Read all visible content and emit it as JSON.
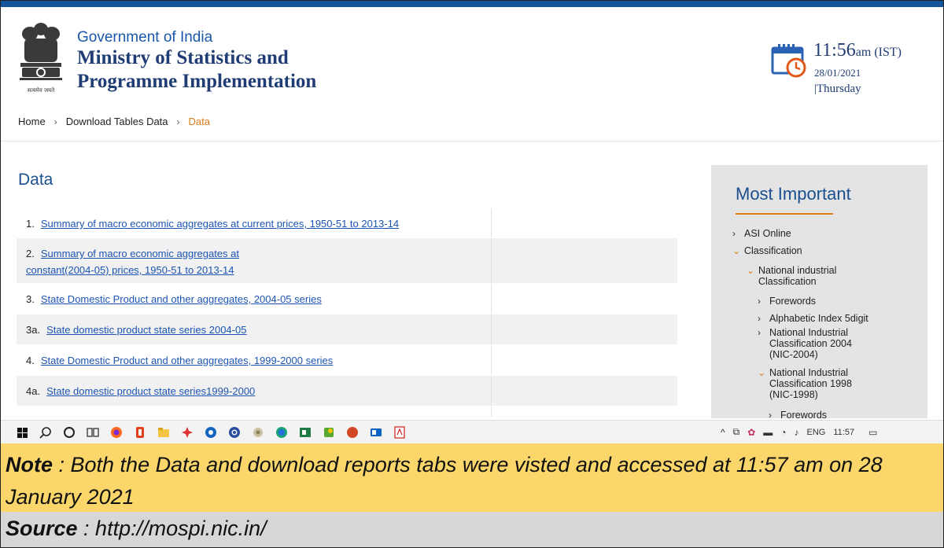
{
  "header": {
    "gov_line": "Government of India",
    "ministry_line1": "Ministry of Statistics and",
    "ministry_line2": "Programme Implementation",
    "emblem_caption": "सत्यमेव जयते"
  },
  "clock": {
    "time": "11:56",
    "ampm": "am (IST)",
    "date": "28/01/2021",
    "day": "|Thursday"
  },
  "breadcrumb": {
    "home": "Home",
    "download_tables": "Download Tables Data",
    "current": "Data"
  },
  "main": {
    "title": "Data",
    "rows": [
      {
        "num": "1.",
        "link": "Summary of macro economic aggregates at current prices, 1950-51 to 2013-14"
      },
      {
        "num": "2.",
        "link": "Summary of macro economic aggregates at constant(2004-05) prices, 1950-51 to 2013-14"
      },
      {
        "num": "3.",
        "link": "State Domestic Product and other aggregates, 2004-05 series"
      },
      {
        "num": "3a.",
        "link": "State domestic product state series 2004-05"
      },
      {
        "num": "4.",
        "link": "State Domestic Product and other aggregates, 1999-2000 series"
      },
      {
        "num": "4a.",
        "link": "State domestic product state series1999-2000"
      }
    ]
  },
  "sidebar": {
    "title": "Most Important",
    "items": [
      {
        "label": "ASI Online",
        "icon": "chevron-right"
      },
      {
        "label": "Classification",
        "icon": "chevron-down"
      },
      {
        "label": "National industrial Classification",
        "icon": "chevron-down"
      },
      {
        "label": "Forewords",
        "icon": "chevron-right"
      },
      {
        "label": "Alphabetic Index 5digit",
        "icon": "chevron-right"
      },
      {
        "label": "National Industrial Classification 2004 (NIC-2004)",
        "icon": "chevron-right"
      },
      {
        "label": "National Industrial Classification 1998 (NIC-1998)",
        "icon": "chevron-down"
      },
      {
        "label": "Forewords",
        "icon": "chevron-right"
      }
    ]
  },
  "taskbar": {
    "language": "ENG",
    "time": "11:57"
  },
  "note": {
    "label": "Note",
    "text": " : Both the Data and download reports tabs were visted and accessed at 11:57 am on 28 January 2021"
  },
  "source": {
    "label": "Source",
    "text": " : http://mospi.nic.in/"
  },
  "colors": {
    "top_bar": "#13569b",
    "ministry_text": "#1f3c74",
    "link": "#1c55b3",
    "accent_orange": "#e07b1a",
    "note_bg": "#fbd66b",
    "source_bg": "#d7d7d7",
    "sidebar_bg": "#e4e4e4"
  }
}
